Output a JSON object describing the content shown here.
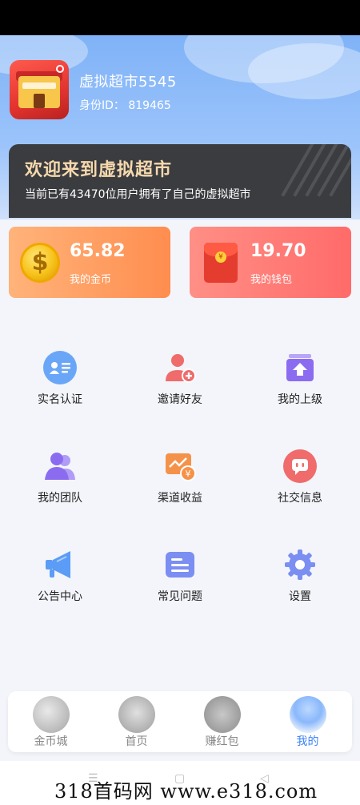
{
  "user": {
    "name": "虚拟超市5545",
    "id_text": "身份ID：  819465"
  },
  "welcome": {
    "title": "欢迎来到虚拟超市",
    "subtitle": "当前已有43470位用户拥有了自己的虚拟超市"
  },
  "cards": [
    {
      "value": "65.82",
      "label": "我的金币",
      "icon": "gold-coin-icon",
      "coin_symbol": "$"
    },
    {
      "value": "19.70",
      "label": "我的钱包",
      "icon": "red-envelope-icon",
      "seal_symbol": "¥"
    }
  ],
  "grid": [
    {
      "label": "实名认证",
      "icon": "id-card-icon",
      "color": "#5b9cf6"
    },
    {
      "label": "邀请好友",
      "icon": "invite-friend-icon",
      "color": "#f06b6b"
    },
    {
      "label": "我的上级",
      "icon": "upline-icon",
      "color": "#8b6cf0"
    },
    {
      "label": "我的团队",
      "icon": "team-icon",
      "color": "#8b6cf0"
    },
    {
      "label": "渠道收益",
      "icon": "channel-income-icon",
      "color": "#f5924a"
    },
    {
      "label": "社交信息",
      "icon": "social-chat-icon",
      "color": "#f06b6b"
    },
    {
      "label": "公告中心",
      "icon": "megaphone-icon",
      "color": "#5b9cf6"
    },
    {
      "label": "常见问题",
      "icon": "faq-list-icon",
      "color": "#7b8ef2"
    },
    {
      "label": "设置",
      "icon": "gear-icon",
      "color": "#7b8ef2"
    }
  ],
  "tabs": [
    {
      "label": "金币城",
      "icon": "coin-city-icon",
      "active": false
    },
    {
      "label": "首页",
      "icon": "home-icon",
      "active": false
    },
    {
      "label": "赚红包",
      "icon": "red-packet-icon",
      "active": false
    },
    {
      "label": "我的",
      "icon": "profile-icon",
      "active": true
    }
  ],
  "colors": {
    "accent": "#3b82f6",
    "header_bg": "#7fb2f7",
    "welcome_bg": "#3b3c40",
    "welcome_title": "#f6d9ad"
  },
  "watermark": "318首码网 www.e318.com"
}
